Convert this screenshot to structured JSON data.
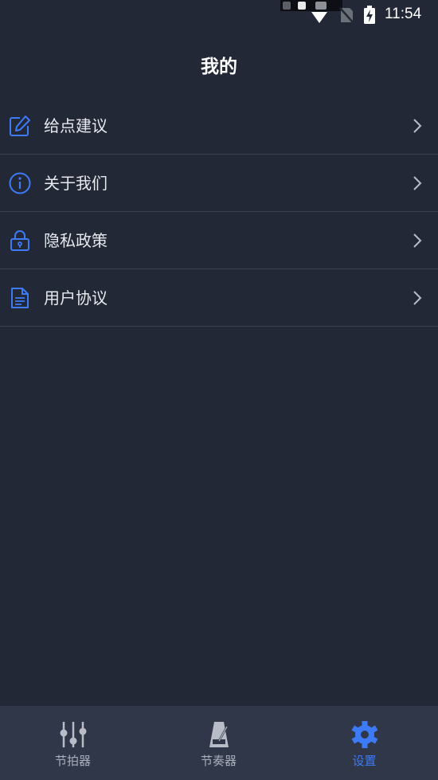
{
  "status_bar": {
    "time": "11:54"
  },
  "header": {
    "title": "我的"
  },
  "menu": {
    "items": [
      {
        "label": "给点建议",
        "icon": "edit-icon"
      },
      {
        "label": "关于我们",
        "icon": "info-icon"
      },
      {
        "label": "隐私政策",
        "icon": "lock-icon"
      },
      {
        "label": "用户协议",
        "icon": "document-icon"
      }
    ]
  },
  "tabs": [
    {
      "label": "节拍器",
      "icon": "sliders-icon",
      "active": false
    },
    {
      "label": "节奏器",
      "icon": "metronome-icon",
      "active": false
    },
    {
      "label": "设置",
      "icon": "gear-icon",
      "active": true
    }
  ],
  "colors": {
    "background": "#232836",
    "accent": "#3d7bf6",
    "tab_bar": "#303748",
    "divider": "#3c4150"
  }
}
